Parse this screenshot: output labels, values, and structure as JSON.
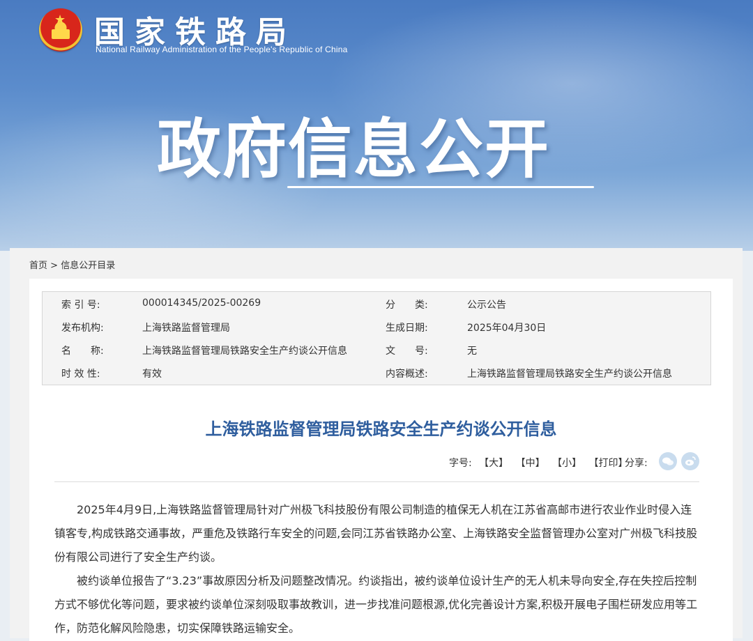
{
  "header": {
    "org_name_cn": "国家铁路局",
    "org_name_en": "National Railway Administration of the People's Republic of China",
    "section_title": "政府信息公开"
  },
  "breadcrumb": {
    "home": "首页",
    "separator": ">",
    "current": "信息公开目录"
  },
  "meta": [
    {
      "label": "索 引 号:",
      "value": "000014345/2025-00269",
      "label2": "分　　类:",
      "value2": "公示公告"
    },
    {
      "label": "发布机构:",
      "value": "上海铁路监督管理局",
      "label2": "生成日期:",
      "value2": "2025年04月30日"
    },
    {
      "label": "名　　称:",
      "value": "上海铁路监督管理局铁路安全生产约谈公开信息",
      "label2": "文　　号:",
      "value2": "无"
    },
    {
      "label": "时 效 性:",
      "value": "有效",
      "label2": "内容概述:",
      "value2": "上海铁路监督管理局铁路安全生产约谈公开信息"
    }
  ],
  "article": {
    "title": "上海铁路监督管理局铁路安全生产约谈公开信息",
    "font_label": "字号:",
    "font_large": "【大】",
    "font_medium": "【中】",
    "font_small": "【小】",
    "print": "【打印】",
    "share_label": "分享:",
    "paragraphs": [
      "2025年4月9日,上海铁路监督管理局针对广州极飞科技股份有限公司制造的植保无人机在江苏省高邮市进行农业作业时侵入连镇客专,构成铁路交通事故，严重危及铁路行车安全的问题,会同江苏省铁路办公室、上海铁路安全监督管理办公室对广州极飞科技股份有限公司进行了安全生产约谈。",
      "被约谈单位报告了“3.23”事故原因分析及问题整改情况。约谈指出，被约谈单位设计生产的无人机未导向安全,存在失控后控制方式不够优化等问题，要求被约谈单位深刻吸取事故教训，进一步找准问题根源,优化完善设计方案,积极开展电子围栏研发应用等工作，防范化解风险隐患，切实保障铁路运输安全。"
    ]
  },
  "colors": {
    "title_blue": "#2f5e9e",
    "banner_blue": "#5b8ccc",
    "share_icon": "#c9dcee"
  },
  "icons": [
    "national-emblem-icon",
    "wechat-icon",
    "weibo-icon"
  ]
}
